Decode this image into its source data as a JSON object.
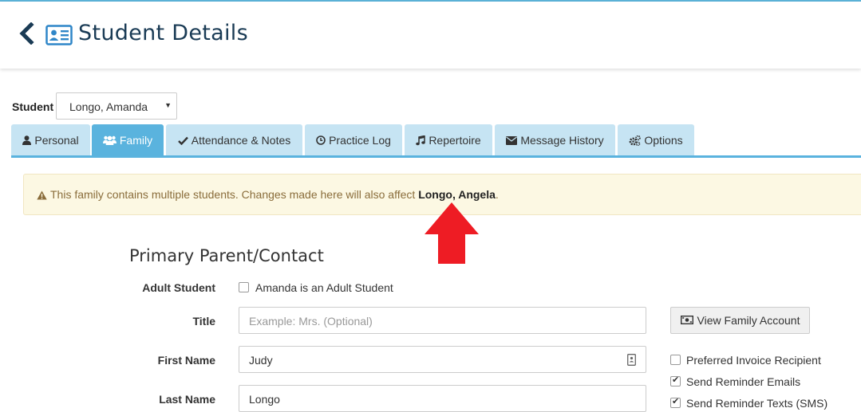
{
  "header": {
    "title": "Student Details"
  },
  "student": {
    "label": "Student",
    "selected": "Longo, Amanda"
  },
  "tabs": [
    {
      "label": "Personal",
      "icon": "user-icon"
    },
    {
      "label": "Family",
      "icon": "users-icon",
      "active": true
    },
    {
      "label": "Attendance & Notes",
      "icon": "check-icon"
    },
    {
      "label": "Practice Log",
      "icon": "clock-icon"
    },
    {
      "label": "Repertoire",
      "icon": "music-icon"
    },
    {
      "label": "Message History",
      "icon": "envelope-icon"
    },
    {
      "label": "Options",
      "icon": "gears-icon"
    }
  ],
  "alert": {
    "text": "This family contains multiple students. Changes made here will also affect ",
    "name": "Longo, Angela",
    "suffix": "."
  },
  "section": {
    "title": "Primary Parent/Contact"
  },
  "form": {
    "adult_label": "Adult Student",
    "adult_checkbox": "Amanda is an Adult Student",
    "adult_checked": false,
    "title_label": "Title",
    "title_placeholder": "Example: Mrs. (Optional)",
    "first_label": "First Name",
    "first_value": "Judy",
    "last_label": "Last Name",
    "last_value": "Longo"
  },
  "side": {
    "view_family_button": "View Family Account",
    "preferred_invoice": "Preferred Invoice Recipient",
    "preferred_invoice_checked": false,
    "reminder_emails": "Send Reminder Emails",
    "reminder_emails_checked": true,
    "reminder_texts": "Send Reminder Texts (SMS)",
    "reminder_texts_checked": true
  },
  "colors": {
    "accent": "#5ab3de",
    "tab_inactive": "#c6e4f3",
    "title": "#1a3b55",
    "alert_bg": "#fcf8e3",
    "alert_text": "#8a6d3b",
    "arrow": "#ee1c24"
  }
}
